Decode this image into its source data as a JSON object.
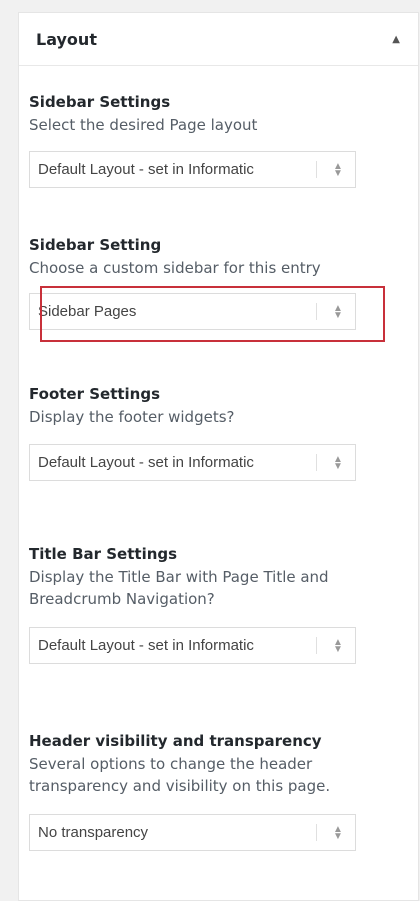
{
  "panel": {
    "title": "Layout",
    "toggle_icon": "▲"
  },
  "sections": [
    {
      "title": "Sidebar Settings",
      "description": "Select the desired Page layout",
      "select_value": "Default Layout - set in Informatic"
    },
    {
      "title": "Sidebar Setting",
      "description": "Choose a custom sidebar for this entry",
      "select_value": "Sidebar Pages"
    },
    {
      "title": "Footer Settings",
      "description": "Display the footer widgets?",
      "select_value": "Default Layout - set in Informatic"
    },
    {
      "title": "Title Bar Settings",
      "description": "Display the Title Bar with Page Title and Breadcrumb Navigation?",
      "select_value": "Default Layout - set in Informatic"
    },
    {
      "title": "Header visibility and transparency",
      "description": "Several options to change the header transparency and visibility on this page.",
      "select_value": "No transparency"
    }
  ],
  "colors": {
    "highlight": "#c8303a"
  }
}
